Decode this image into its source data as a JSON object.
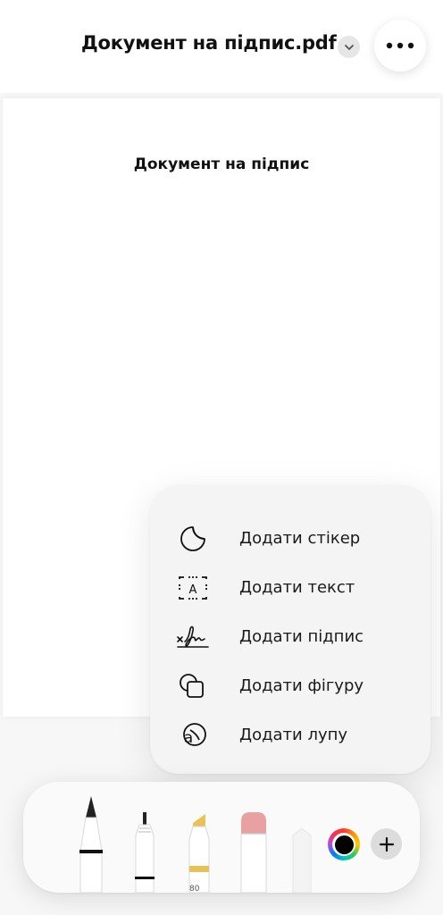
{
  "header": {
    "document_title": "Документ на підпис.pdf"
  },
  "document": {
    "heading": "Документ на підпис"
  },
  "add_menu": {
    "items": [
      {
        "label": "Додати стікер",
        "icon": "sticker-icon"
      },
      {
        "label": "Додати текст",
        "icon": "text-box-icon"
      },
      {
        "label": "Додати підпис",
        "icon": "signature-icon"
      },
      {
        "label": "Додати фігуру",
        "icon": "shapes-icon"
      },
      {
        "label": "Додати лупу",
        "icon": "magnifier-icon"
      }
    ]
  },
  "toolbar": {
    "tools": [
      {
        "name": "pen",
        "icon": "pen-tool-icon"
      },
      {
        "name": "fineliner",
        "icon": "fineliner-tool-icon"
      },
      {
        "name": "highlighter",
        "icon": "highlighter-tool-icon",
        "opacity_label": "80"
      },
      {
        "name": "eraser",
        "icon": "eraser-tool-icon"
      },
      {
        "name": "lasso",
        "icon": "lasso-tool-icon"
      }
    ],
    "current_color": "#000000",
    "add_icon": "plus-icon"
  },
  "colors": {
    "highlighter_yellow": "#e8c257",
    "eraser_pink": "#e8a0a0",
    "menu_background": "#f4f4f4"
  }
}
